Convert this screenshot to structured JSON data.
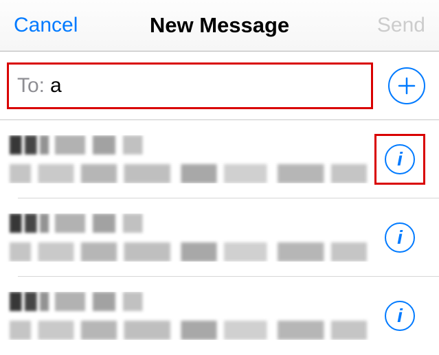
{
  "navbar": {
    "cancel": "Cancel",
    "title": "New Message",
    "send": "Send"
  },
  "compose": {
    "to_label": "To:",
    "to_value": "a"
  },
  "suggestions": [
    {
      "name_redacted": true,
      "detail_redacted": true,
      "info_highlighted": true
    },
    {
      "name_redacted": true,
      "detail_redacted": true,
      "info_highlighted": false
    },
    {
      "name_redacted": true,
      "detail_redacted": true,
      "info_highlighted": false
    }
  ],
  "icons": {
    "plus": "plus",
    "info_glyph": "i"
  }
}
